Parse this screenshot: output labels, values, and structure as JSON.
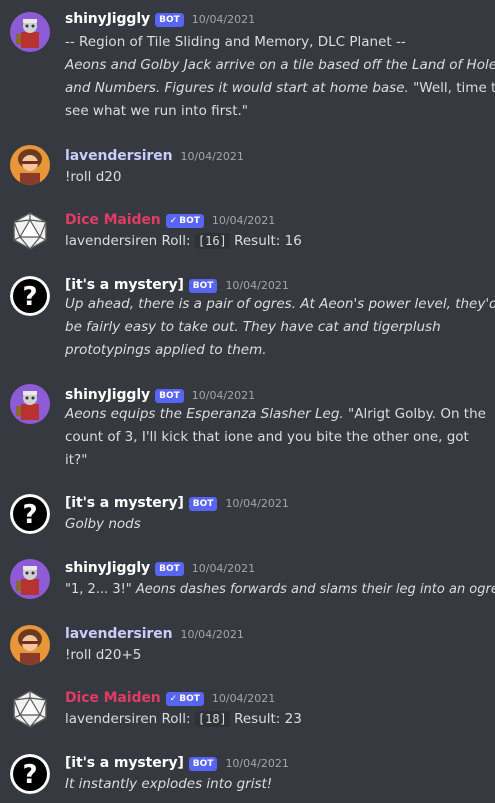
{
  "colors": {
    "background": "#36393f",
    "text": "#dcddde",
    "timestamp": "#a3a6aa",
    "bot_badge": "#5865f2",
    "shiny": "#ffffff",
    "lavender": "#c9cdfb",
    "dice_maiden": "#e03c63",
    "mystery": "#ffffff"
  },
  "badges": {
    "bot": "BOT",
    "verified_check": "✓"
  },
  "messages": [
    {
      "author": "shinyJiggly",
      "bot": true,
      "timestamp": "10/04/2021",
      "lines": [
        [
          {
            "t": "-- Region of Tile Sliding and Memory, DLC Planet --",
            "i": false
          }
        ],
        [
          {
            "t": "Aeons and Golby Jack arrive on a tile based off the Land of Holes",
            "i": true
          }
        ],
        [
          {
            "t": "and Numbers. Figures it would start at home base.",
            "i": true
          },
          {
            "t": " \"Well, time to",
            "i": false
          }
        ],
        [
          {
            "t": "see what we run into first.\"",
            "i": false
          }
        ]
      ]
    },
    {
      "author": "lavendersiren",
      "bot": false,
      "timestamp": "10/04/2021",
      "lines": [
        [
          {
            "t": "!roll d20",
            "i": false
          }
        ]
      ]
    },
    {
      "author": "Dice Maiden",
      "bot": true,
      "verified": true,
      "timestamp": "10/04/2021",
      "roll": {
        "prefix": "lavendersiren Roll:",
        "dice": "[16]",
        "result": "Result: 16"
      }
    },
    {
      "author": "[it's a mystery]",
      "bot": true,
      "timestamp": "10/04/2021",
      "lines": [
        [
          {
            "t": "Up ahead, there is a pair of ogres. At Aeon's power level, they'd",
            "i": true
          }
        ],
        [
          {
            "t": "be fairly easy to take out. They have cat and tigerplush",
            "i": true
          }
        ],
        [
          {
            "t": "prototypings applied to them.",
            "i": true
          }
        ]
      ]
    },
    {
      "author": "shinyJiggly",
      "bot": true,
      "timestamp": "10/04/2021",
      "lines": [
        [
          {
            "t": "Aeons equips the Esperanza Slasher Leg.",
            "i": true
          },
          {
            "t": " \"Alrigt Golby. On the",
            "i": false
          }
        ],
        [
          {
            "t": "count of 3, I'll kick that ione and you bite the other one, got",
            "i": false
          }
        ],
        [
          {
            "t": "it?\"",
            "i": false
          }
        ]
      ]
    },
    {
      "author": "[it's a mystery]",
      "bot": true,
      "timestamp": "10/04/2021",
      "lines": [
        [
          {
            "t": "Golby nods",
            "i": true
          }
        ]
      ]
    },
    {
      "author": "shinyJiggly",
      "bot": true,
      "timestamp": "10/04/2021",
      "lines": [
        [
          {
            "t": "\"1, 2... 3!\"",
            "i": false
          },
          {
            "t": " Aeons dashes forwards and slams their leg into an ogre!",
            "i": true
          }
        ]
      ]
    },
    {
      "author": "lavendersiren",
      "bot": false,
      "timestamp": "10/04/2021",
      "lines": [
        [
          {
            "t": "!roll d20+5",
            "i": false
          }
        ]
      ]
    },
    {
      "author": "Dice Maiden",
      "bot": true,
      "verified": true,
      "timestamp": "10/04/2021",
      "roll": {
        "prefix": "lavendersiren Roll:",
        "dice": "[18]",
        "result": "Result: 23"
      }
    },
    {
      "author": "[it's a mystery]",
      "bot": true,
      "timestamp": "10/04/2021",
      "lines": [
        [
          {
            "t": "It instantly explodes into grist!",
            "i": true
          }
        ]
      ]
    }
  ]
}
